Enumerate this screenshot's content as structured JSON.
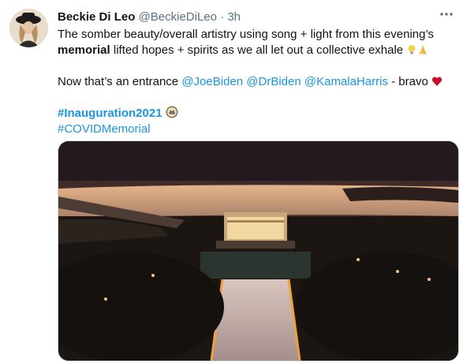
{
  "tweet": {
    "display_name": "Beckie Di Leo",
    "handle": "@BeckieDiLeo",
    "separator": "·",
    "time": "3h",
    "text_line1": "The somber beauty/overall artistry using song + light from this evening’s",
    "text_bold": "memorial",
    "text_line2": " lifted hopes + spirits as we all let out a collective exhale",
    "entrance_text": "Now that’s an entrance ",
    "mentions": [
      "@JoeBiden",
      "@DrBiden",
      "@KamalaHarris"
    ],
    "bravo_text": " - bravo",
    "hashtags": [
      "#Inauguration2021",
      "#COVIDMemorial"
    ],
    "badge_number": "46"
  },
  "icons": {
    "more": "more-icon",
    "lightbulb": "lightbulb-emoji",
    "pray": "folded-hands-emoji",
    "heart": "red-heart-emoji"
  },
  "colors": {
    "link": "#1b95e0",
    "heart": "#c8102e",
    "badge": "#8a6d3b"
  }
}
